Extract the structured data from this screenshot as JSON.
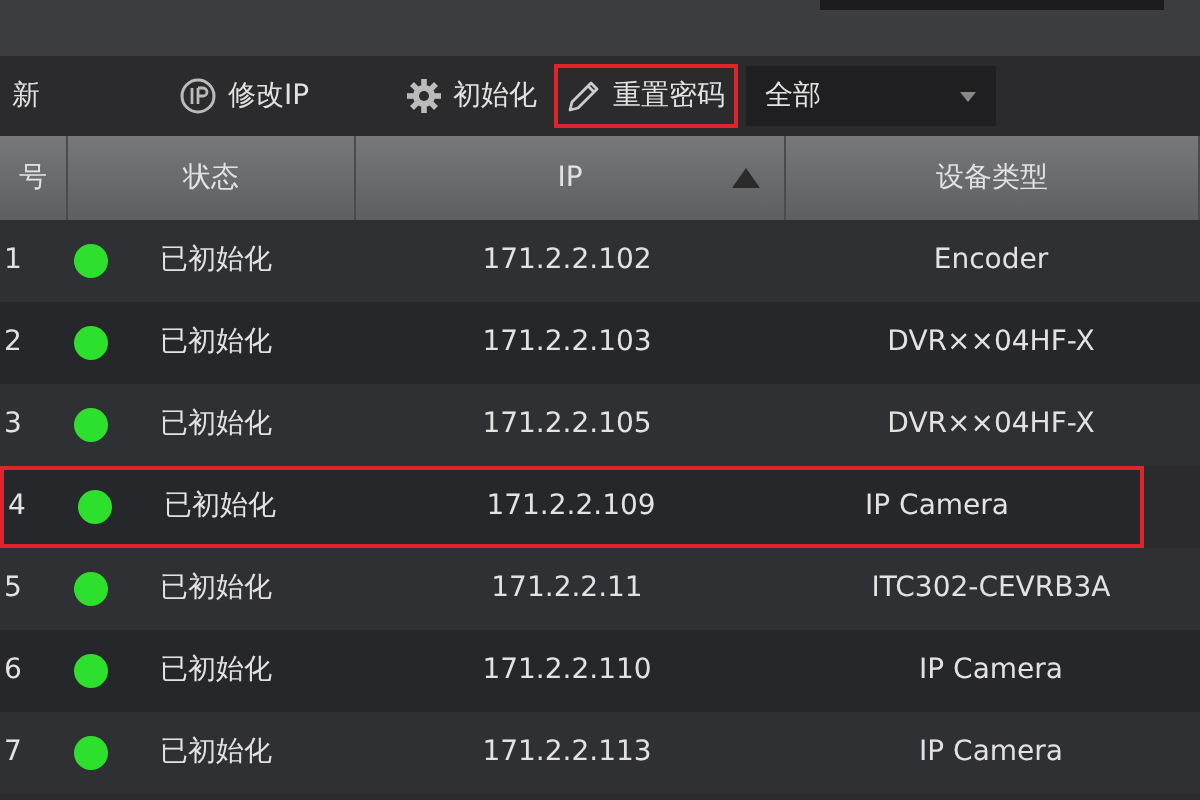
{
  "toolbar": {
    "items": [
      {
        "kind": "text",
        "label": "新",
        "highlighted": false
      },
      {
        "kind": "ip",
        "label": "修改IP",
        "highlighted": false
      },
      {
        "kind": "gear",
        "label": "初始化",
        "highlighted": false
      },
      {
        "kind": "pencil",
        "label": "重置密码",
        "highlighted": true
      }
    ],
    "filter": {
      "value": "全部"
    }
  },
  "table": {
    "columns": [
      {
        "label": "号",
        "sorted": false
      },
      {
        "label": "状态",
        "sorted": false
      },
      {
        "label": "IP",
        "sorted": true
      },
      {
        "label": "设备类型",
        "sorted": false
      }
    ],
    "rows": [
      {
        "no": "1",
        "color": "#2ee02e",
        "status": "已初始化",
        "ip": "171.2.2.102",
        "type": "Encoder",
        "highlighted": false
      },
      {
        "no": "2",
        "color": "#2ee02e",
        "status": "已初始化",
        "ip": "171.2.2.103",
        "type": "DVR××04HF-X",
        "highlighted": false
      },
      {
        "no": "3",
        "color": "#2ee02e",
        "status": "已初始化",
        "ip": "171.2.2.105",
        "type": "DVR××04HF-X",
        "highlighted": false
      },
      {
        "no": "4",
        "color": "#2ee02e",
        "status": "已初始化",
        "ip": "171.2.2.109",
        "type": "IP Camera",
        "highlighted": true
      },
      {
        "no": "5",
        "color": "#2ee02e",
        "status": "已初始化",
        "ip": "171.2.2.11",
        "type": "ITC302-CEVRB3A",
        "highlighted": false
      },
      {
        "no": "6",
        "color": "#2ee02e",
        "status": "已初始化",
        "ip": "171.2.2.110",
        "type": "IP Camera",
        "highlighted": false
      },
      {
        "no": "7",
        "color": "#2ee02e",
        "status": "已初始化",
        "ip": "171.2.2.113",
        "type": "IP Camera",
        "highlighted": false
      }
    ]
  }
}
